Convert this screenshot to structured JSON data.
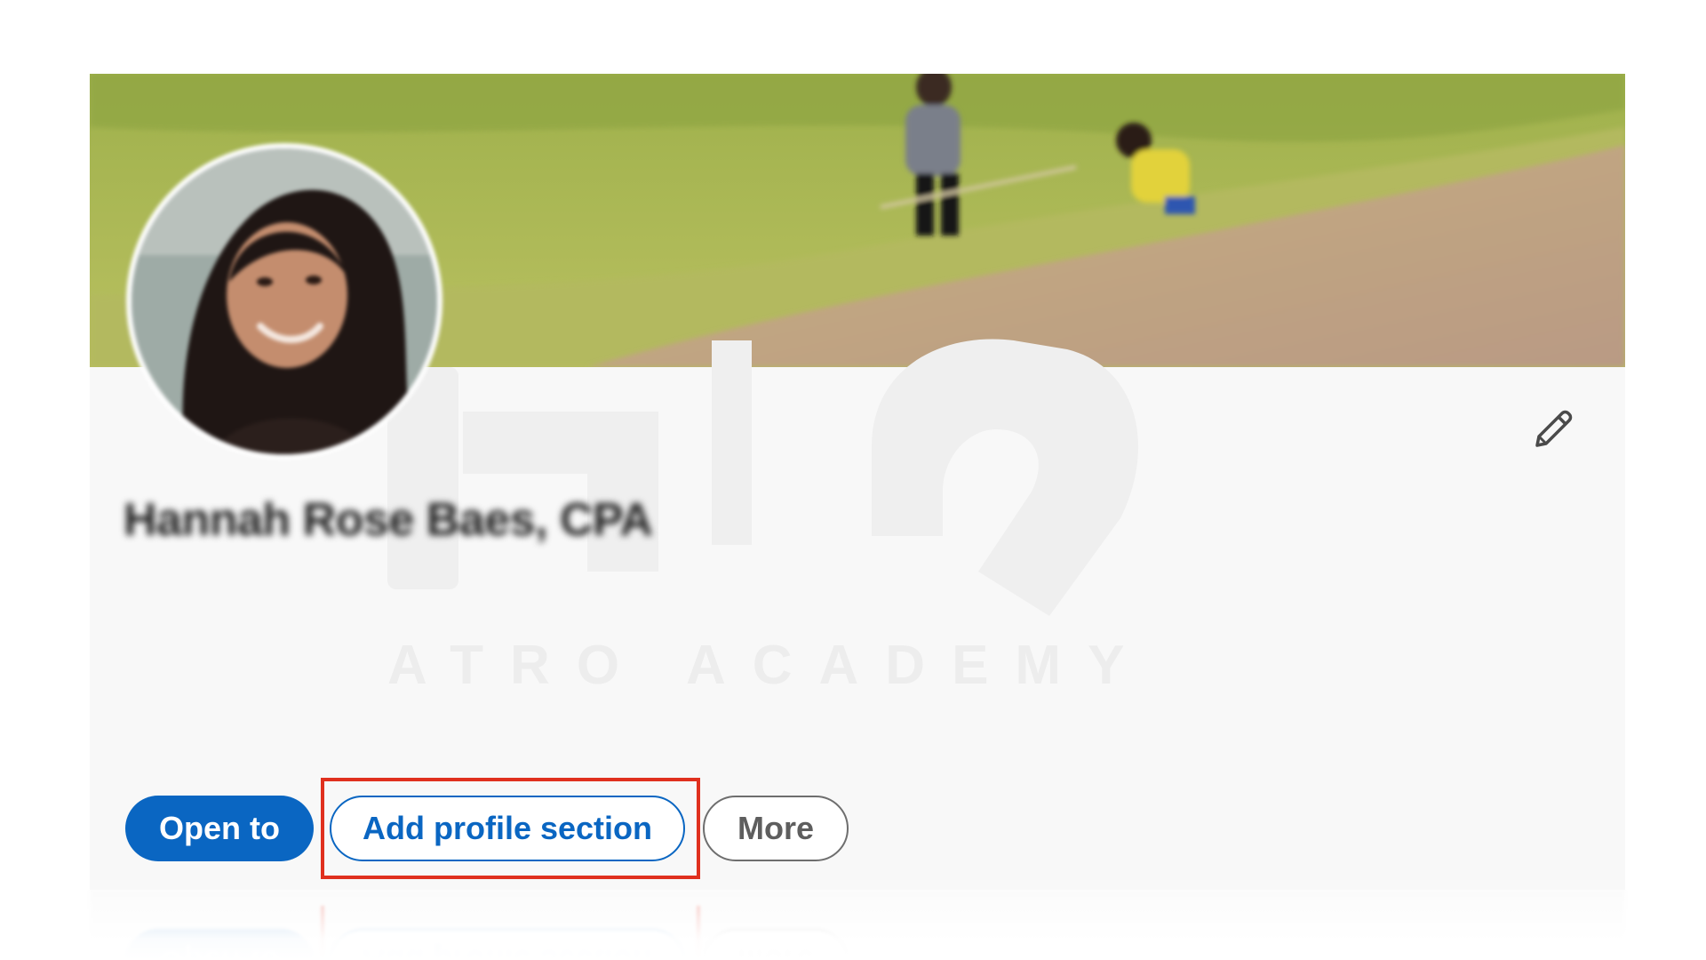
{
  "profile": {
    "name": "Hannah Rose Baes, CPA"
  },
  "actions": {
    "open_to_label": "Open to",
    "add_section_label": "Add profile section",
    "more_label": "More"
  },
  "watermark": {
    "text": "ATRO ACADEMY"
  },
  "icons": {
    "edit": "pencil-icon"
  },
  "colors": {
    "primary": "#0a66c2",
    "highlight": "#e0301e",
    "card_bg": "#f8f8f8"
  }
}
